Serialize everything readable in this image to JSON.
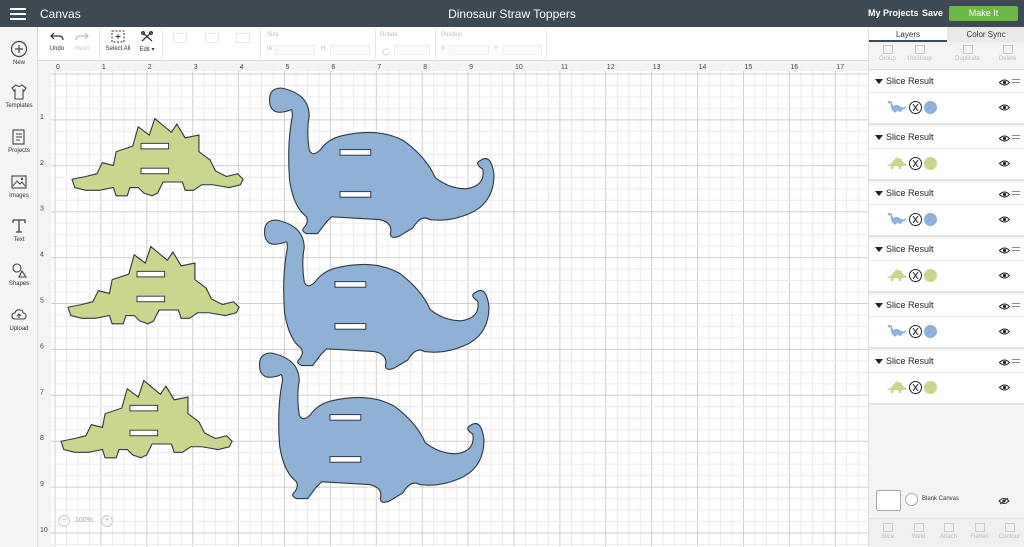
{
  "header": {
    "app_title": "Canvas",
    "doc_title": "Dinosaur Straw Toppers",
    "my_projects": "My Projects",
    "save": "Save",
    "make_it": "Make It"
  },
  "sidebar": {
    "items": [
      {
        "label": "New",
        "icon": "plus-circle-icon"
      },
      {
        "label": "Templates",
        "icon": "tshirt-icon"
      },
      {
        "label": "Projects",
        "icon": "projects-icon"
      },
      {
        "label": "Images",
        "icon": "images-icon"
      },
      {
        "label": "Text",
        "icon": "text-icon"
      },
      {
        "label": "Shapes",
        "icon": "shapes-icon"
      },
      {
        "label": "Upload",
        "icon": "upload-cloud-icon"
      }
    ]
  },
  "toolbar": {
    "undo": "Undo",
    "redo": "Redo",
    "select_all": "Select All",
    "edit": "Edit",
    "size_label": "Size",
    "w_label": "W",
    "h_label": "H",
    "rotate_label": "Rotate",
    "position_label": "Position",
    "x_label": "X",
    "y_label": "Y"
  },
  "ruler": {
    "top": [
      "0",
      "1",
      "2",
      "3",
      "4",
      "5",
      "6",
      "7",
      "8",
      "9",
      "10",
      "11",
      "12",
      "13",
      "14",
      "15",
      "16",
      "17"
    ],
    "left": [
      "1",
      "2",
      "3",
      "4",
      "5",
      "6",
      "7",
      "8",
      "9",
      "10"
    ]
  },
  "zoom": {
    "value": "100%",
    "minus": "−",
    "plus": "+"
  },
  "panel": {
    "tabs": [
      "Layers",
      "Color Sync"
    ],
    "actions": [
      "Group",
      "UnGroup",
      "Duplicate",
      "Delete"
    ],
    "layers": [
      {
        "title": "Slice Result",
        "shape": "brontosaurus",
        "color": "#8fb1d6"
      },
      {
        "title": "Slice Result",
        "shape": "stegosaurus",
        "color": "#c8d68e"
      },
      {
        "title": "Slice Result",
        "shape": "brontosaurus",
        "color": "#8fb1d6"
      },
      {
        "title": "Slice Result",
        "shape": "stegosaurus",
        "color": "#c8d68e"
      },
      {
        "title": "Slice Result",
        "shape": "brontosaurus",
        "color": "#8fb1d6"
      },
      {
        "title": "Slice Result",
        "shape": "stegosaurus",
        "color": "#c8d68e"
      }
    ],
    "blank_canvas": "Blank Canvas",
    "bottom_actions": [
      "Slice",
      "Weld",
      "Attach",
      "Flatten",
      "Contour"
    ]
  },
  "colors": {
    "stegosaurus": "#c8d68e",
    "brontosaurus": "#8fb1d6",
    "topbar": "#3d4a54",
    "make_it": "#6ab945"
  }
}
